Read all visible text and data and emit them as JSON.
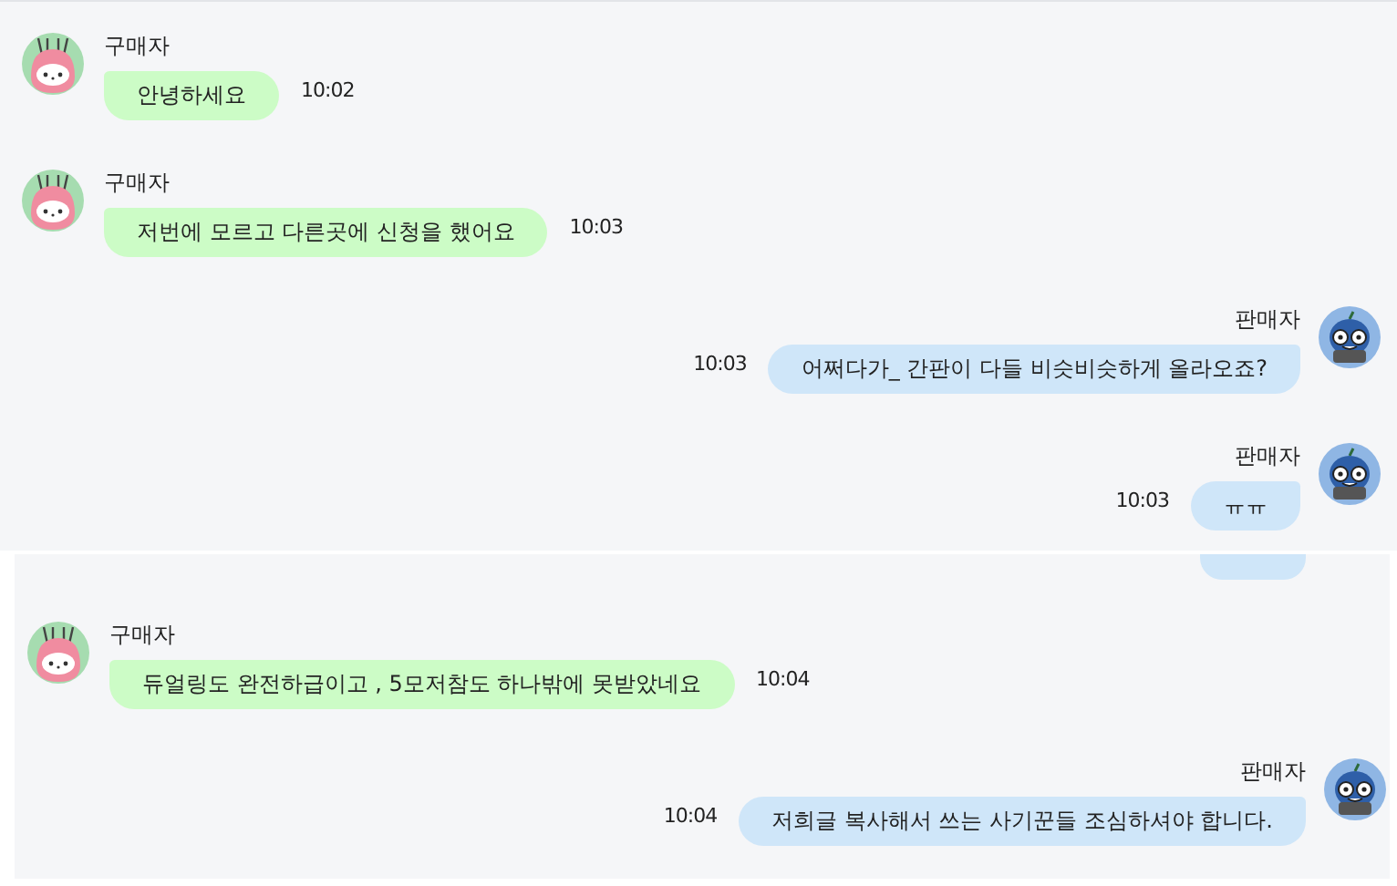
{
  "panels": [
    {
      "messages": [
        {
          "kind": "buyer",
          "sender": "구매자",
          "text": "안녕하세요",
          "time": "10:02"
        },
        {
          "kind": "buyer",
          "sender": "구매자",
          "text": "저번에 모르고 다른곳에 신청을 했어요",
          "time": "10:03"
        },
        {
          "kind": "seller",
          "sender": "판매자",
          "text": "어쩌다가_ 간판이 다들 비슷비슷하게 올라오죠?",
          "time": "10:03"
        },
        {
          "kind": "seller",
          "sender": "판매자",
          "text": "ㅠㅠ",
          "time": "10:03"
        }
      ]
    },
    {
      "top_fragment": true,
      "messages": [
        {
          "kind": "buyer",
          "sender": "구매자",
          "text": "듀얼링도 완전하급이고 , 5모저참도 하나밖에 못받았네요",
          "time": "10:04"
        },
        {
          "kind": "seller",
          "sender": "판매자",
          "text": "저희글 복사해서 쓰는 사기꾼들 조심하셔야 합니다.",
          "time": "10:04"
        }
      ]
    }
  ]
}
